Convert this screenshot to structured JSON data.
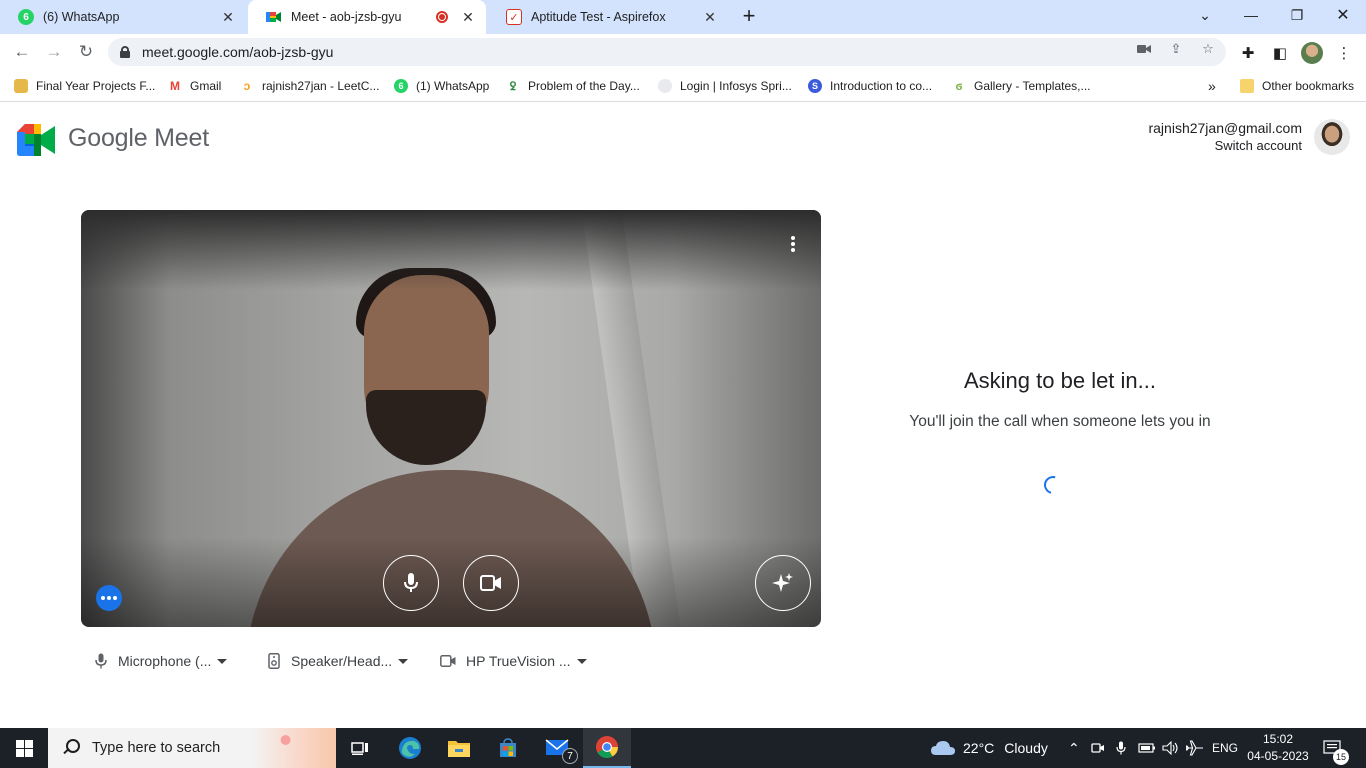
{
  "browser": {
    "tabs": [
      {
        "title": "(6) WhatsApp",
        "favicon": "whatsapp-icon",
        "favicon_text": "6",
        "favicon_color": "#25d366"
      },
      {
        "title": "Meet - aob-jzsb-gyu",
        "favicon": "google-meet-icon",
        "recording": true
      },
      {
        "title": "Aptitude Test - Aspirefox",
        "favicon": "checkbox-icon"
      }
    ],
    "url": "meet.google.com/aob-jzsb-gyu",
    "bookmarks": [
      {
        "label": "Final Year Projects F...",
        "icon": "bookmark-icon"
      },
      {
        "label": "Gmail",
        "icon": "gmail-icon"
      },
      {
        "label": "rajnish27jan - LeetC...",
        "icon": "leetcode-icon"
      },
      {
        "label": "(1) WhatsApp",
        "icon": "whatsapp-icon",
        "icon_text": "6"
      },
      {
        "label": "Problem of the Day...",
        "icon": "geeksforgeeks-icon"
      },
      {
        "label": "Login | Infosys Spri...",
        "icon": "infosys-icon"
      },
      {
        "label": "Introduction to co...",
        "icon": "course-icon"
      },
      {
        "label": "Gallery - Templates,...",
        "icon": "gallery-icon"
      }
    ],
    "other_bookmarks": "Other bookmarks",
    "overflow": "»"
  },
  "page": {
    "brand": "Google Meet",
    "account_email": "rajnish27jan@gmail.com",
    "switch_account": "Switch account",
    "status_title": "Asking to be let in...",
    "status_text": "You'll join the call when someone lets you in",
    "devices": {
      "microphone": "Microphone (...",
      "speaker": "Speaker/Head...",
      "camera": "HP TrueVision ..."
    }
  },
  "taskbar": {
    "search_placeholder": "Type here to search",
    "weather_temp": "22°C",
    "weather_desc": "Cloudy",
    "language": "ENG",
    "time": "15:02",
    "date": "04-05-2023",
    "mail_badge": "7",
    "notification_count": "15"
  },
  "colors": {
    "tabstrip": "#d3e3fd",
    "accent": "#1a73e8",
    "taskbar": "#1c2127"
  }
}
